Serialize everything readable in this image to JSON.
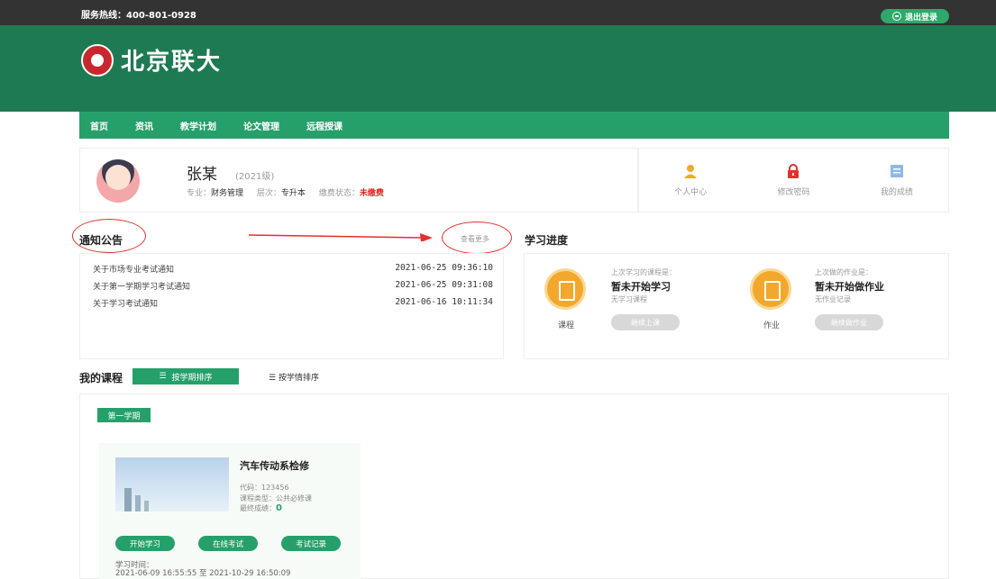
{
  "topbar": {
    "hotline": "服务热线：400-801-0928",
    "logout_label": "退出登录"
  },
  "header": {
    "site_name": "北京联大"
  },
  "nav": {
    "items": [
      "首页",
      "资讯",
      "教学计划",
      "论文管理",
      "远程授课"
    ]
  },
  "profile": {
    "name": "张某",
    "grade": "(2021级)",
    "major_label": "专业：",
    "major": "财务管理",
    "level_label": "层次：",
    "level": "专升本",
    "fee_label": "缴费状态：",
    "fee_status": "未缴费"
  },
  "quick_links": [
    {
      "label": "个人中心",
      "icon": "user-icon"
    },
    {
      "label": "修改密码",
      "icon": "lock-icon"
    },
    {
      "label": "我的成绩",
      "icon": "grades-icon"
    }
  ],
  "notice": {
    "title": "通知公告",
    "more": "查看更多",
    "items": [
      {
        "title": "关于市场专业考试通知",
        "date": "2021-06-25 09:36:10"
      },
      {
        "title": "关于第一学期学习考试通知",
        "date": "2021-06-25 09:31:08"
      },
      {
        "title": "关于学习考试通知",
        "date": "2021-06-16 10:11:34"
      }
    ]
  },
  "progress": {
    "title": "学习进度",
    "course": {
      "last_label": "上次学习的课程是：",
      "status": "暂未开始学习",
      "sub": "无学习课程",
      "label": "课程",
      "button": "继续上课"
    },
    "homework": {
      "last_label": "上次做的作业是：",
      "status": "暂未开始做作业",
      "sub": "无作业记录",
      "label": "作业",
      "button": "继续做作业"
    }
  },
  "courses": {
    "title": "我的课程",
    "sort_term": "按学期排序",
    "sort_status": "按学情排序",
    "term_tag": "第一学期",
    "card": {
      "name": "汽车传动系检修",
      "code": "代码：123456",
      "type": "课程类型：公共必修课",
      "score_label": "最终成绩：",
      "score": "0",
      "btn_study": "开始学习",
      "btn_exam": "在线考试",
      "btn_record": "考试记录",
      "time_label": "学习时间：",
      "time_range": "2021-06-09 16:55:55  至  2021-10-29 16:50:09"
    }
  },
  "colors": {
    "brand_green": "#1e7a52",
    "nav_green": "#26a06b",
    "accent_orange": "#f2a82c",
    "alert_red": "#e52525"
  }
}
